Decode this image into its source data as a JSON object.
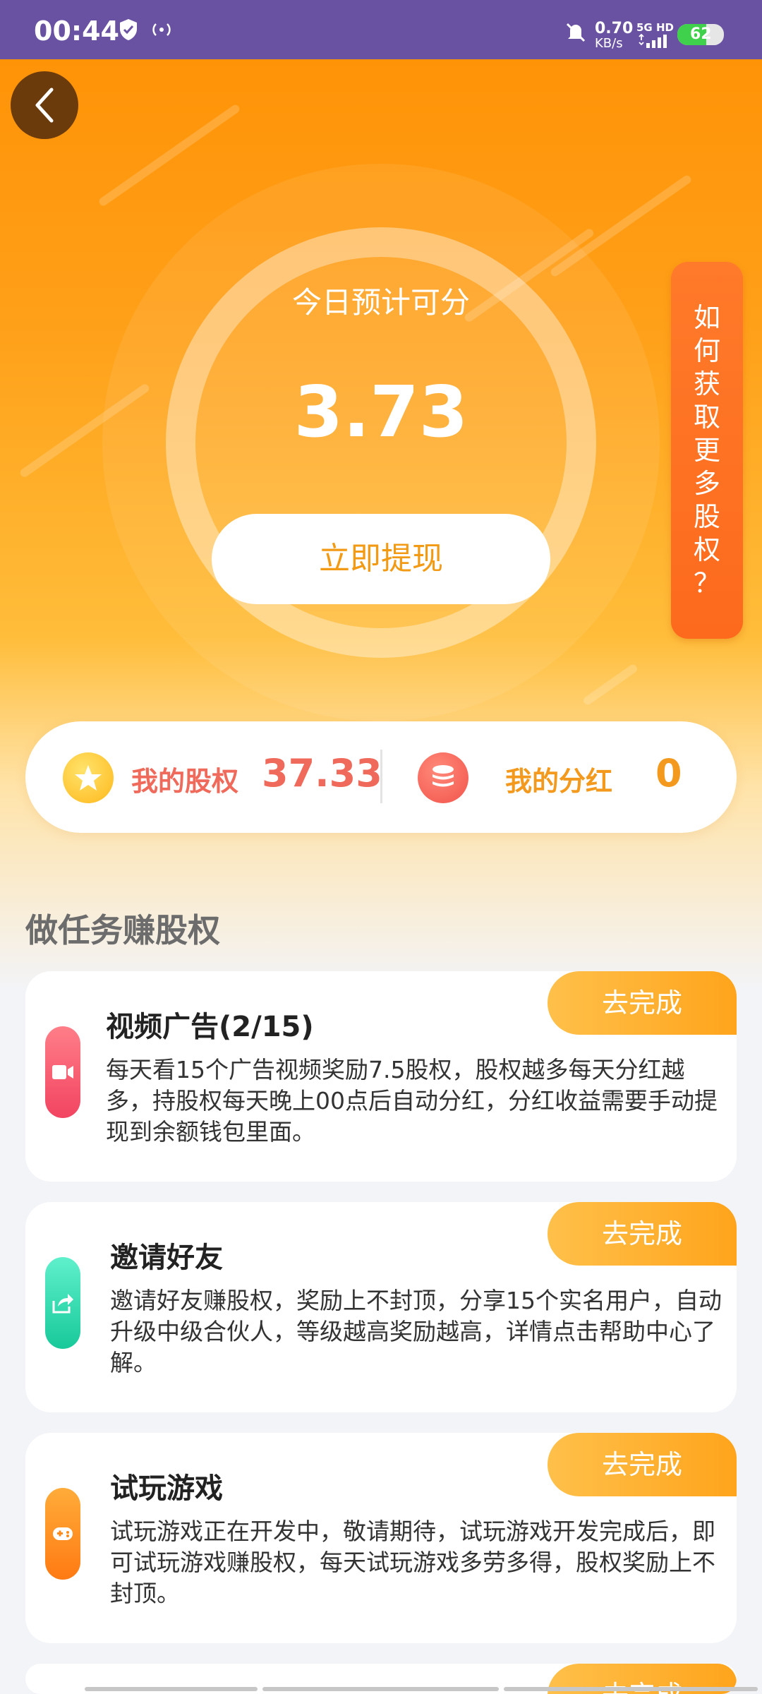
{
  "status_bar": {
    "time": "00:44",
    "network_speed": "0.70",
    "network_unit": "KB/s",
    "signal_label": "5G HD",
    "battery": "62"
  },
  "hero": {
    "today_label": "今日预计可分",
    "today_value": "3.73",
    "withdraw_label": "立即提现",
    "how_to_label": [
      "如",
      "何",
      "获",
      "取",
      "更",
      "多",
      "股",
      "权",
      "？"
    ]
  },
  "stats": {
    "equity_label": "我的股权",
    "equity_value": "37.33",
    "dividend_label": "我的分红",
    "dividend_value": "0"
  },
  "section_title": "做任务赚股权",
  "tasks": [
    {
      "title": "视频广告(2/15)",
      "desc": "每天看15个广告视频奖励7.5股权，股权越多每天分红越多，持股权每天晚上00点后自动分红，分红收益需要手动提现到余额钱包里面。",
      "button": "去完成",
      "icon": "video-icon",
      "color": "#f4546d"
    },
    {
      "title": "邀请好友",
      "desc": "邀请好友赚股权，奖励上不封顶，分享15个实名用户，自动升级中级合伙人，等级越高奖励越高，详情点击帮助中心了解。",
      "button": "去完成",
      "icon": "share-icon",
      "color": "#22d4a8"
    },
    {
      "title": "试玩游戏",
      "desc": "试玩游戏正在开发中，敬请期待，试玩游戏开发完成后，即可试玩游戏赚股权，每天试玩游戏多劳多得，股权奖励上不封顶。",
      "button": "去完成",
      "icon": "gamepad-icon",
      "color": "#ff8a1a"
    },
    {
      "button": "去完成"
    }
  ]
}
